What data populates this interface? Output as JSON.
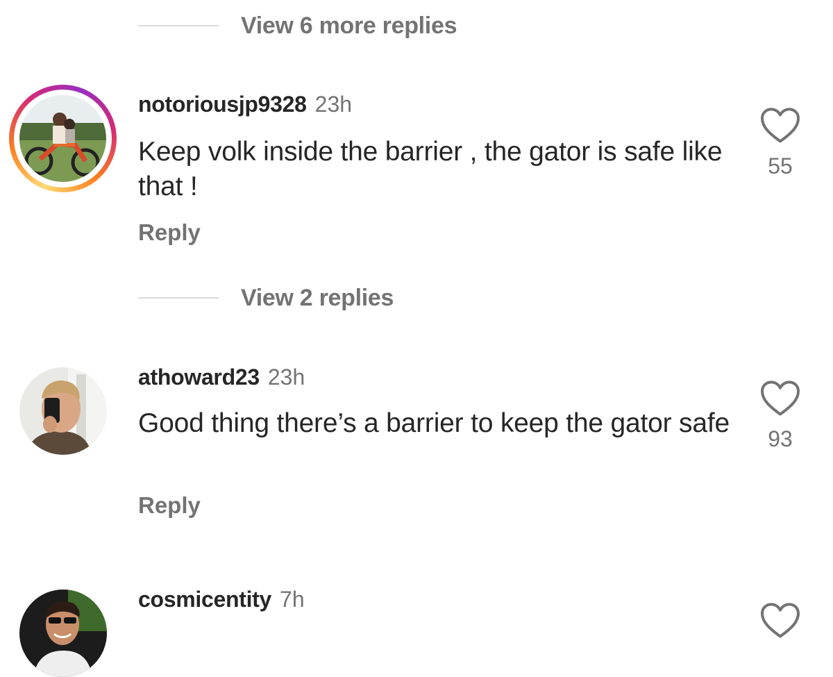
{
  "thread": {
    "view_more_top": "View 6 more replies",
    "view_replies_mid": "View 2 replies"
  },
  "comments": [
    {
      "username": "notoriousjp9328",
      "time": "23h",
      "text": "Keep volk inside the barrier , the gator is safe like that !",
      "reply_label": "Reply",
      "likes": "55",
      "avatar_icon": "motocross-rider-avatar",
      "has_story_ring": true
    },
    {
      "username": "athoward23",
      "time": "23h",
      "text": "Good thing there’s a barrier to keep the gator safe",
      "reply_label": "Reply",
      "likes": "93",
      "avatar_icon": "selfie-avatar",
      "has_story_ring": false
    },
    {
      "username": "cosmicentity",
      "time": "7h",
      "avatar_icon": "sunglasses-man-avatar",
      "has_story_ring": false
    }
  ],
  "colors": {
    "text_primary": "#262626",
    "text_secondary": "#737373",
    "divider": "#dbdbdb",
    "story_ring": [
      "#feda75",
      "#fa7e1e",
      "#d62976",
      "#962fbf"
    ]
  }
}
